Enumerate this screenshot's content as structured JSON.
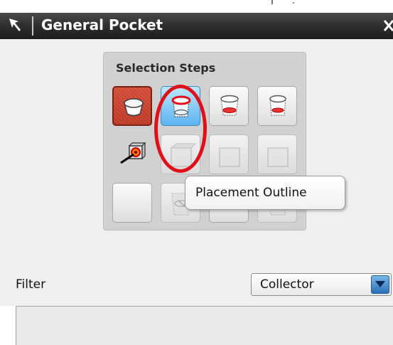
{
  "window": {
    "title": "General Pocket",
    "icons": {
      "pin": "pin-icon",
      "close": "close-icon"
    }
  },
  "selection_steps": {
    "label": "Selection Steps",
    "rows": [
      [
        {
          "name": "placement-face",
          "icon": "pocket-placement-face-icon",
          "state": "active"
        },
        {
          "name": "placement-outline",
          "icon": "pocket-placement-outline-icon",
          "state": "hovered"
        },
        {
          "name": "floor-outline",
          "icon": "pocket-floor-outline-icon",
          "state": "normal"
        },
        {
          "name": "target-body",
          "icon": "pocket-target-body-icon",
          "state": "normal"
        }
      ],
      [
        {
          "name": "thru-face",
          "icon": "thru-face-icon",
          "state": "normal"
        },
        {
          "name": "face-step-2",
          "icon": "face-select-icon",
          "state": "disabled"
        },
        {
          "name": "face-step-3",
          "icon": "face-select-icon",
          "state": "disabled"
        },
        {
          "name": "face-step-4",
          "icon": "face-select-icon",
          "state": "disabled"
        }
      ],
      [
        {
          "name": "empty-step-1",
          "icon": "blank-icon",
          "state": "normal"
        },
        {
          "name": "sketch-step-1",
          "icon": "sketch-select-icon",
          "state": "disabled"
        },
        {
          "name": "empty-step-2",
          "icon": "blank-icon",
          "state": "normal"
        },
        {
          "name": "sketch-step-2",
          "icon": "sketch-select-icon",
          "state": "disabled"
        }
      ]
    ]
  },
  "tooltip": {
    "text": "Placement Outline"
  },
  "filter": {
    "label": "Filter",
    "selected": "Collector",
    "arrow_icon": "chevron-down-icon"
  },
  "colors": {
    "title_bar": "#2c2c2c",
    "active_step": "#d9472f",
    "hover_step": "#5ab4ee",
    "highlight_ring": "#e0101a"
  }
}
